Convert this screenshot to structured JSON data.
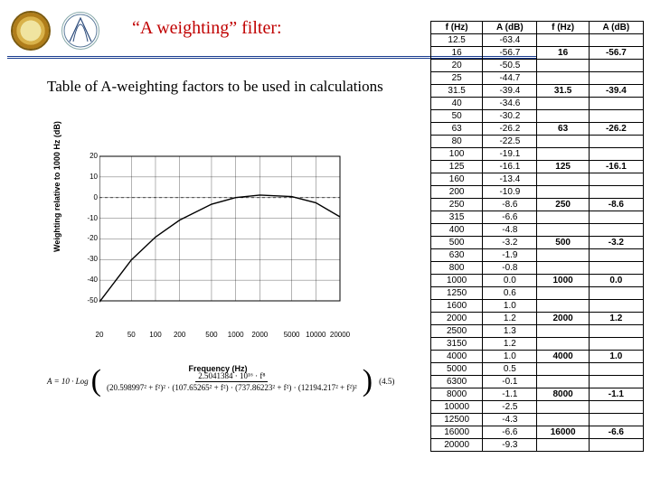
{
  "header": {
    "title_open_quote": "“",
    "title_text": "A weighting",
    "title_close_quote": "”",
    "title_rest": " filter:"
  },
  "caption": "Table of A-weighting factors to be used in calculations",
  "chart_data": {
    "type": "line",
    "xlabel": "Frequency (Hz)",
    "ylabel": "Weighting relative to 1000 Hz (dB)",
    "xscale": "log",
    "xlim": [
      20,
      20000
    ],
    "ylim": [
      -50,
      20
    ],
    "yticks": [
      20,
      10,
      0,
      -10,
      -20,
      -30,
      -40,
      -50
    ],
    "xticks": [
      20,
      50,
      100,
      200,
      500,
      1000,
      2000,
      5000,
      10000,
      20000
    ],
    "series": [
      {
        "name": "A-weighting",
        "x": [
          20,
          50,
          100,
          200,
          500,
          1000,
          2000,
          5000,
          10000,
          20000
        ],
        "y": [
          -50.5,
          -30.2,
          -19.1,
          -10.9,
          -3.2,
          0.0,
          1.2,
          0.5,
          -2.5,
          -9.3
        ]
      }
    ],
    "reference_line_y": 0
  },
  "formula": {
    "lhs": "A = 10 · Log",
    "num": "2.5041384 · 10¹⁶ · f⁸",
    "den": "(20.598997² + f²)² · (107.65265² + f²) · (737.86223² + f²) · (12194.217² + f²)²",
    "eqno": "(4.5)"
  },
  "table": {
    "headers": [
      "f (Hz)",
      "A (dB)",
      "f (Hz)",
      "A (dB)"
    ],
    "rows": [
      [
        "12.5",
        "-63.4",
        "",
        ""
      ],
      [
        "16",
        "-56.7",
        "16",
        "-56.7"
      ],
      [
        "20",
        "-50.5",
        "",
        ""
      ],
      [
        "25",
        "-44.7",
        "",
        ""
      ],
      [
        "31.5",
        "-39.4",
        "31.5",
        "-39.4"
      ],
      [
        "40",
        "-34.6",
        "",
        ""
      ],
      [
        "50",
        "-30.2",
        "",
        ""
      ],
      [
        "63",
        "-26.2",
        "63",
        "-26.2"
      ],
      [
        "80",
        "-22.5",
        "",
        ""
      ],
      [
        "100",
        "-19.1",
        "",
        ""
      ],
      [
        "125",
        "-16.1",
        "125",
        "-16.1"
      ],
      [
        "160",
        "-13.4",
        "",
        ""
      ],
      [
        "200",
        "-10.9",
        "",
        ""
      ],
      [
        "250",
        "-8.6",
        "250",
        "-8.6"
      ],
      [
        "315",
        "-6.6",
        "",
        ""
      ],
      [
        "400",
        "-4.8",
        "",
        ""
      ],
      [
        "500",
        "-3.2",
        "500",
        "-3.2"
      ],
      [
        "630",
        "-1.9",
        "",
        ""
      ],
      [
        "800",
        "-0.8",
        "",
        ""
      ],
      [
        "1000",
        "0.0",
        "1000",
        "0.0"
      ],
      [
        "1250",
        "0.6",
        "",
        ""
      ],
      [
        "1600",
        "1.0",
        "",
        ""
      ],
      [
        "2000",
        "1.2",
        "2000",
        "1.2"
      ],
      [
        "2500",
        "1.3",
        "",
        ""
      ],
      [
        "3150",
        "1.2",
        "",
        ""
      ],
      [
        "4000",
        "1.0",
        "4000",
        "1.0"
      ],
      [
        "5000",
        "0.5",
        "",
        ""
      ],
      [
        "6300",
        "-0.1",
        "",
        ""
      ],
      [
        "8000",
        "-1.1",
        "8000",
        "-1.1"
      ],
      [
        "10000",
        "-2.5",
        "",
        ""
      ],
      [
        "12500",
        "-4.3",
        "",
        ""
      ],
      [
        "16000",
        "-6.6",
        "16000",
        "-6.6"
      ],
      [
        "20000",
        "-9.3",
        "",
        ""
      ]
    ]
  }
}
